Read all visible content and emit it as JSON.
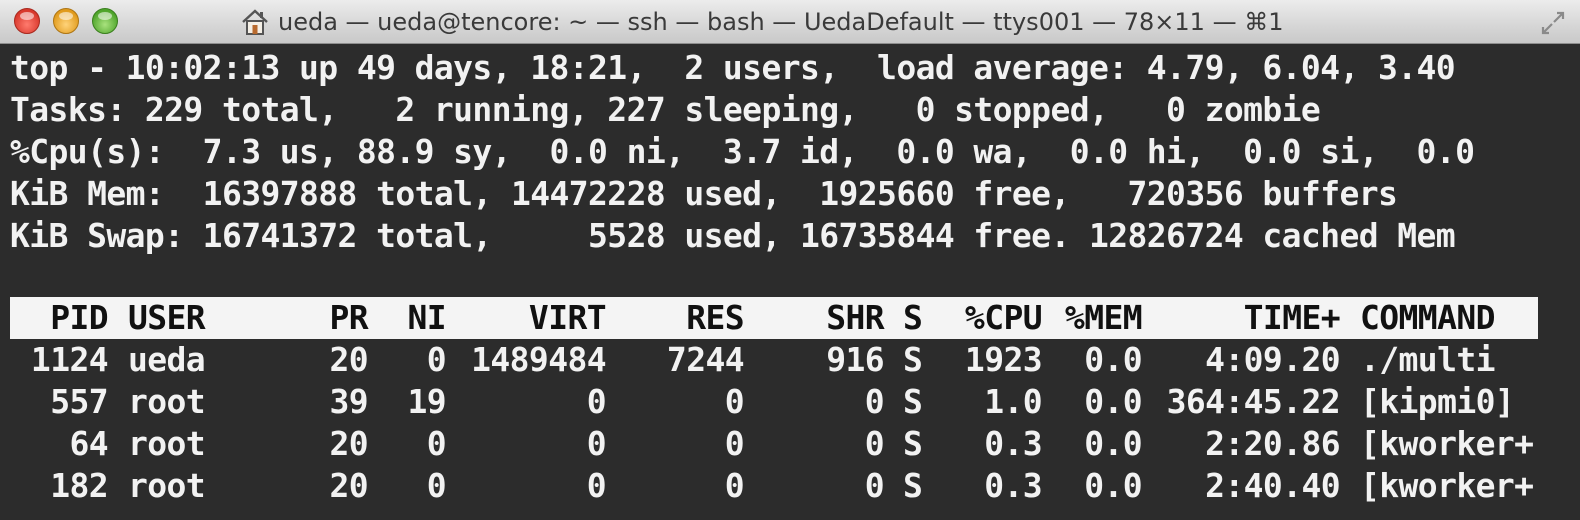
{
  "window": {
    "title": "ueda — ueda@tencore: ~ — ssh — bash — UedaDefault — ttys001 — 78×11 — ⌘1",
    "icons": {
      "title_icon": "home-icon",
      "resize": "fullscreen-arrows-icon"
    }
  },
  "summary": {
    "line1": "top - 10:02:13 up 49 days, 18:21,  2 users,  load average: 4.79, 6.04, 3.40",
    "line2": "Tasks: 229 total,   2 running, 227 sleeping,   0 stopped,   0 zombie",
    "line3": "%Cpu(s):  7.3 us, 88.9 sy,  0.0 ni,  3.7 id,  0.0 wa,  0.0 hi,  0.0 si,  0.0",
    "line4": "KiB Mem:  16397888 total, 14472228 used,  1925660 free,   720356 buffers",
    "line5": "KiB Swap: 16741372 total,     5528 used, 16735844 free. 12826724 cached Mem"
  },
  "table": {
    "headers": {
      "pid": "PID",
      "user": "USER",
      "pr": "PR",
      "ni": "NI",
      "virt": "VIRT",
      "res": "RES",
      "shr": "SHR",
      "s": "S",
      "cpu": "%CPU",
      "mem": "%MEM",
      "time": "TIME+",
      "command": "COMMAND"
    },
    "rows": [
      {
        "pid": "1124",
        "user": "ueda",
        "pr": "20",
        "ni": "0",
        "virt": "1489484",
        "res": "7244",
        "shr": "916",
        "s": "S",
        "cpu": "1923",
        "mem": "0.0",
        "time": "4:09.20",
        "command": "./multi"
      },
      {
        "pid": "557",
        "user": "root",
        "pr": "39",
        "ni": "19",
        "virt": "0",
        "res": "0",
        "shr": "0",
        "s": "S",
        "cpu": "1.0",
        "mem": "0.0",
        "time": "364:45.22",
        "command": "[kipmi0]"
      },
      {
        "pid": "64",
        "user": "root",
        "pr": "20",
        "ni": "0",
        "virt": "0",
        "res": "0",
        "shr": "0",
        "s": "S",
        "cpu": "0.3",
        "mem": "0.0",
        "time": "2:20.86",
        "command": "[kworker+"
      },
      {
        "pid": "182",
        "user": "root",
        "pr": "20",
        "ni": "0",
        "virt": "0",
        "res": "0",
        "shr": "0",
        "s": "S",
        "cpu": "0.3",
        "mem": "0.0",
        "time": "2:40.40",
        "command": "[kworker+"
      }
    ]
  },
  "colors": {
    "terminal_bg": "#2c2c2c",
    "terminal_fg": "#f2f2f2",
    "header_bg": "#f4f4f4"
  }
}
